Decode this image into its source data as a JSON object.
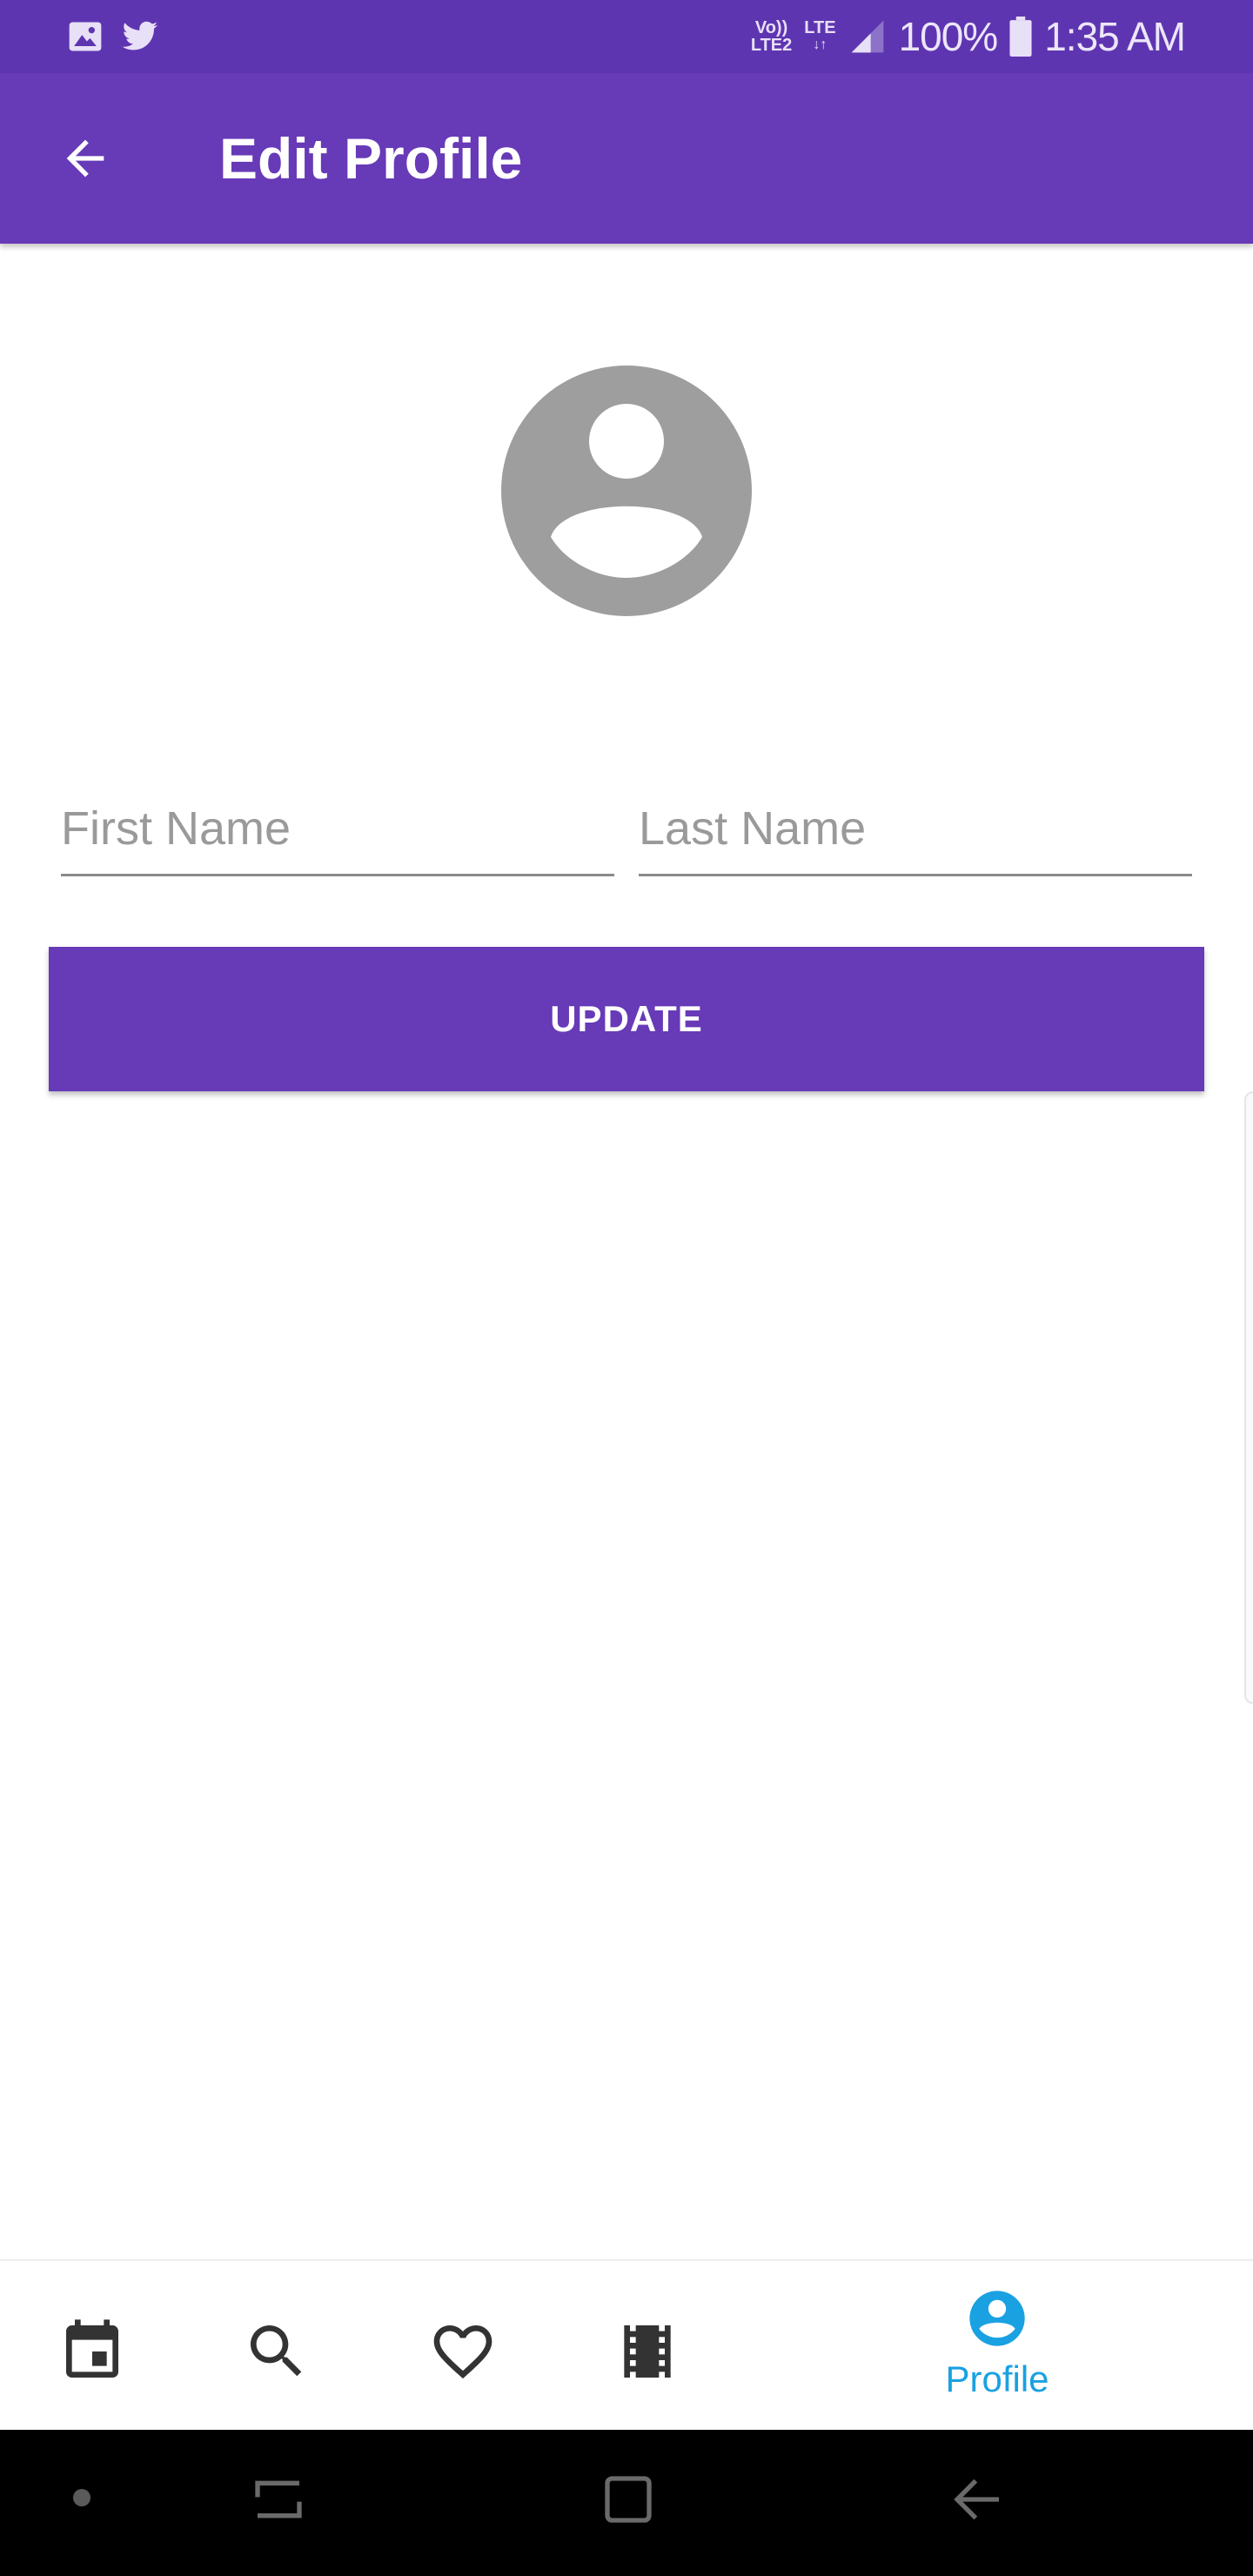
{
  "status_bar": {
    "notification_icons": [
      "image-icon",
      "twitter-icon"
    ],
    "volte_label_top": "Vo))",
    "volte_label_bottom": "LTE2",
    "lte_label": "LTE",
    "battery": "100%",
    "time": "1:35 AM"
  },
  "app_bar": {
    "title": "Edit Profile",
    "back_icon": "arrow-back-icon"
  },
  "profile": {
    "avatar_icon": "account-circle-icon"
  },
  "form": {
    "first_name": {
      "value": "",
      "placeholder": "First Name"
    },
    "last_name": {
      "value": "",
      "placeholder": "Last Name"
    },
    "update_label": "UPDATE"
  },
  "bottom_nav": {
    "items": [
      {
        "icon": "calendar-icon",
        "label": ""
      },
      {
        "icon": "search-icon",
        "label": ""
      },
      {
        "icon": "heart-icon",
        "label": ""
      },
      {
        "icon": "film-icon",
        "label": ""
      },
      {
        "icon": "account-circle-icon",
        "label": "Profile",
        "selected": true
      }
    ]
  },
  "colors": {
    "primary": "#673ab7",
    "status_bar": "#5e35b1",
    "accent_selected": "#1aa1e2",
    "avatar_gray": "#9e9e9e"
  }
}
